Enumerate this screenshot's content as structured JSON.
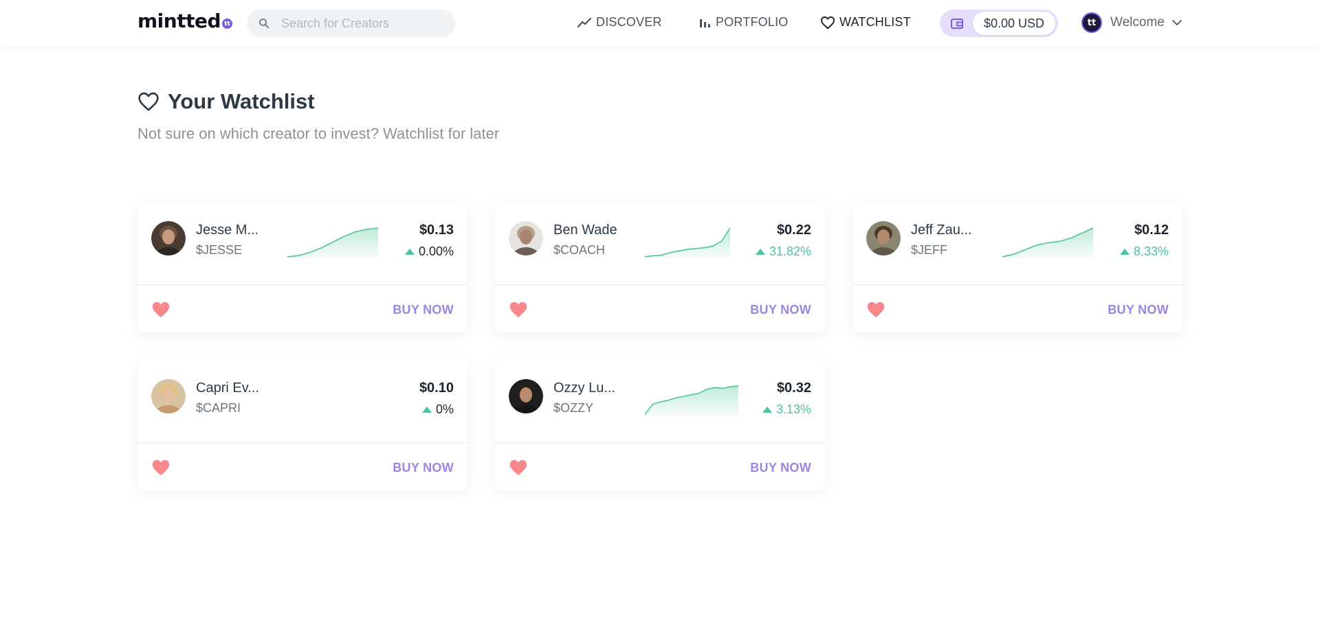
{
  "header": {
    "logo": {
      "text": "mintted",
      "badge": "tt"
    },
    "search": {
      "placeholder": "Search for Creators",
      "value": ""
    },
    "nav": [
      {
        "label": "DISCOVER",
        "icon": "trend-line-icon"
      },
      {
        "label": "PORTFOLIO",
        "icon": "bar-chart-icon"
      },
      {
        "label": "WATCHLIST",
        "icon": "heart-outline-icon"
      }
    ],
    "wallet": {
      "balance": "$0.00 USD",
      "icon": "wallet-icon"
    },
    "user": {
      "avatar_text": "tt",
      "label": "Welcome",
      "icon": "chevron-down-icon"
    }
  },
  "page": {
    "title": "Your Watchlist",
    "subtitle": "Not sure on which creator to invest? Watchlist for later"
  },
  "colors": {
    "accent": "#9b86e0",
    "brand": "#7b5ce6",
    "positive": "#4cc596",
    "heart": "#f7888b"
  },
  "cards": [
    {
      "name": "Jesse M...",
      "ticker": "$JESSE",
      "price": "$0.13",
      "change": "0.00%",
      "trend": "flat",
      "buy_label": "BUY NOW",
      "spark": [
        1,
        3,
        8,
        15,
        24,
        33,
        40,
        44,
        46
      ]
    },
    {
      "name": "Ben Wade",
      "ticker": "$COACH",
      "price": "$0.22",
      "change": "31.82%",
      "trend": "up",
      "buy_label": "BUY NOW",
      "spark": [
        1,
        2,
        3,
        6,
        8,
        10,
        11,
        12,
        14,
        20,
        36
      ]
    },
    {
      "name": "Jeff Zau...",
      "ticker": "$JEFF",
      "price": "$0.12",
      "change": "8.33%",
      "trend": "up",
      "buy_label": "BUY NOW",
      "spark": [
        1,
        5,
        12,
        19,
        23,
        25,
        30,
        38,
        46
      ]
    },
    {
      "name": "Capri Ev...",
      "ticker": "$CAPRI",
      "price": "$0.10",
      "change": "0%",
      "trend": "flat",
      "buy_label": "BUY NOW",
      "spark": []
    },
    {
      "name": "Ozzy Lu...",
      "ticker": "$OZZY",
      "price": "$0.32",
      "change": "3.13%",
      "trend": "up",
      "buy_label": "BUY NOW",
      "spark": [
        1,
        14,
        17,
        19,
        22,
        24,
        26,
        28,
        33,
        35,
        34,
        36,
        37
      ]
    }
  ]
}
